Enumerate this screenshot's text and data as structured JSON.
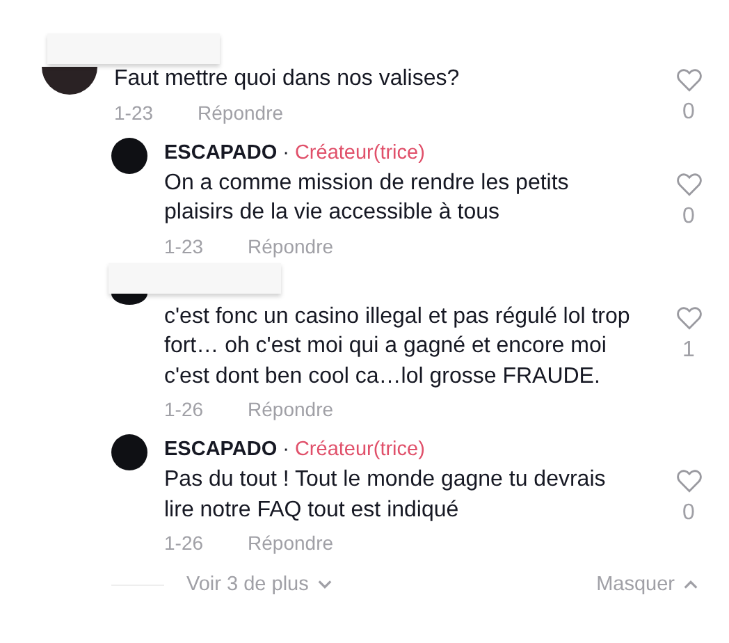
{
  "comments": [
    {
      "kind": "redacted",
      "text": "Faut mettre quoi dans nos valises?",
      "date": "1-23",
      "reply_label": "Répondre",
      "likes": "0",
      "liked": false,
      "replies": [
        {
          "kind": "creator",
          "author": "ESCAPADO",
          "separator": "·",
          "badge": "Créateur(trice)",
          "text": "On a comme mission de rendre les petits plaisirs de la vie accessible à tous",
          "date": "1-23",
          "reply_label": "Répondre",
          "likes": "0",
          "liked": false
        },
        {
          "kind": "redacted",
          "text": "c'est fonc un casino illegal et pas régulé lol trop fort… oh c'est moi qui a gagné et encore moi c'est dont ben cool ca…lol grosse FRAUDE.",
          "date": "1-26",
          "reply_label": "Répondre",
          "likes": "1",
          "liked": false
        },
        {
          "kind": "creator",
          "author": "ESCAPADO",
          "separator": "·",
          "badge": "Créateur(trice)",
          "text": "Pas du tout ! Tout le monde gagne tu devrais lire notre FAQ tout est indiqué",
          "date": "1-26",
          "reply_label": "Répondre",
          "likes": "0",
          "liked": false
        }
      ],
      "more_label": "Voir 3 de plus",
      "hide_label": "Masquer"
    }
  ]
}
